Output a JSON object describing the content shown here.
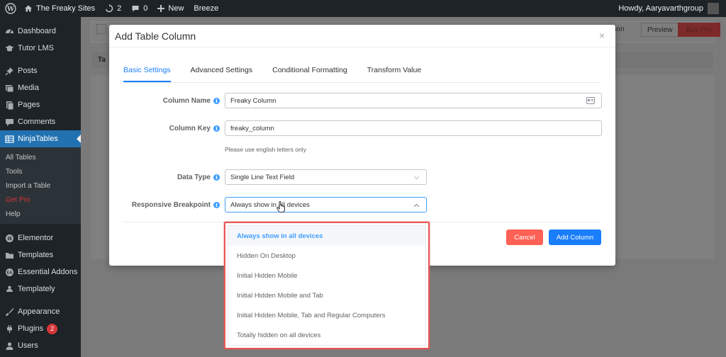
{
  "adminbar": {
    "site_name": "The Freaky Sites",
    "updates_count": "2",
    "comments_count": "0",
    "new_label": "New",
    "breeze_label": "Breeze",
    "howdy": "Howdy, Aaryavarthgroup"
  },
  "sidebar": {
    "items": [
      {
        "label": "Dashboard",
        "icon": "dashboard-icon"
      },
      {
        "label": "Tutor LMS",
        "icon": "graduation-cap-icon"
      },
      {
        "label": "Posts",
        "icon": "pin-icon"
      },
      {
        "label": "Media",
        "icon": "media-icon"
      },
      {
        "label": "Pages",
        "icon": "pages-icon"
      },
      {
        "label": "Comments",
        "icon": "comment-icon"
      },
      {
        "label": "NinjaTables",
        "icon": "table-icon"
      }
    ],
    "submenu": [
      {
        "label": "All Tables"
      },
      {
        "label": "Tools"
      },
      {
        "label": "Import a Table"
      },
      {
        "label": "Get Pro"
      },
      {
        "label": "Help"
      }
    ],
    "items2": [
      {
        "label": "Elementor",
        "icon": "elementor-icon"
      },
      {
        "label": "Templates",
        "icon": "folder-icon"
      },
      {
        "label": "Essential Addons",
        "icon": "ea-icon"
      },
      {
        "label": "Templately",
        "icon": "templately-icon"
      },
      {
        "label": "Appearance",
        "icon": "brush-icon"
      },
      {
        "label": "Plugins",
        "icon": "plugin-icon",
        "badge": "2"
      },
      {
        "label": "Users",
        "icon": "user-icon"
      }
    ]
  },
  "background": {
    "tab_label": "Ta",
    "right_text": "ation",
    "preview_label": "Preview",
    "buy_pro_label": "Buy Pro"
  },
  "modal": {
    "title": "Add Table Column",
    "close": "×",
    "tabs": [
      {
        "label": "Basic Settings"
      },
      {
        "label": "Advanced Settings"
      },
      {
        "label": "Conditional Formatting"
      },
      {
        "label": "Transform Value"
      }
    ],
    "fields": {
      "column_name": {
        "label": "Column Name",
        "value": "Freaky Column"
      },
      "column_key": {
        "label": "Column Key",
        "value": "freaky_column",
        "hint": "Please use english letters only"
      },
      "data_type": {
        "label": "Data Type",
        "value": "Single Line Text Field"
      },
      "responsive_breakpoint": {
        "label": "Responsive Breakpoint",
        "value": "Always show in all devices"
      }
    },
    "cancel_label": "Cancel",
    "add_label": "Add Column"
  },
  "dropdown": {
    "options": [
      {
        "label": "Always show in all devices"
      },
      {
        "label": "Hidden On Desktop"
      },
      {
        "label": "Initial Hidden Mobile"
      },
      {
        "label": "Initial Hidden Mobile and Tab"
      },
      {
        "label": "Initial Hidden Mobile, Tab and Regular Computers"
      },
      {
        "label": "Totally hidden on all devices"
      }
    ]
  },
  "colors": {
    "primary": "#1a7efb",
    "danger": "#ff6154",
    "highlight_border": "#e95757",
    "wp_dark": "#1d2327",
    "wp_active": "#2271b1"
  }
}
